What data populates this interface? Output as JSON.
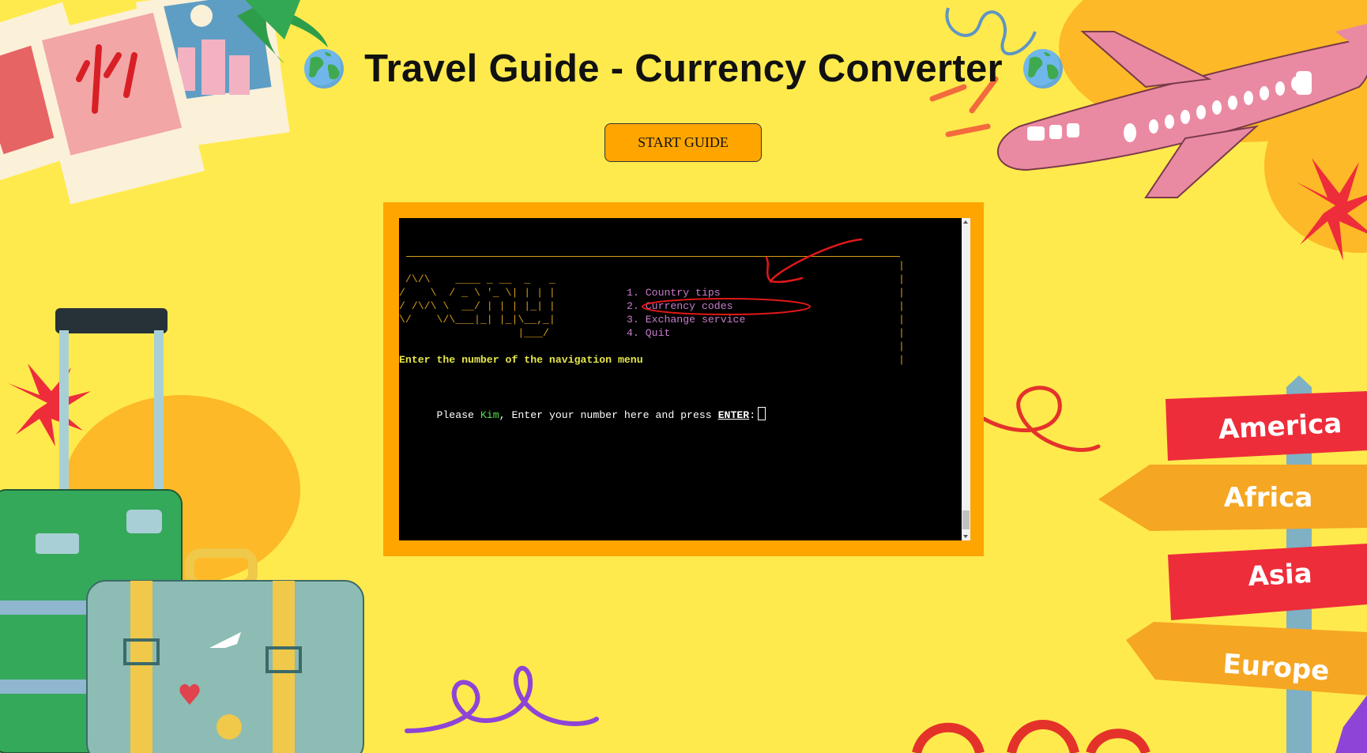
{
  "header": {
    "title": "Travel Guide - Currency Converter",
    "left_icon": "globe-icon",
    "right_icon": "globe-icon"
  },
  "start_button": {
    "label": "START GUIDE"
  },
  "terminal": {
    "ascii_art": [
      " /\\/\\    ____ _ __  _   _ ",
      "/    \\  / _ \\ '_ \\| | | |",
      "/ /\\/\\ \\  __/ | | | |_| |",
      "\\/    \\/\\___|_| |_|\\__,_|",
      "                   |___/"
    ],
    "menu_items": [
      "1. Country tips",
      "2. Currency codes",
      "3. Exchange service",
      "4. Quit"
    ],
    "instruction": "Enter the number of the navigation menu",
    "prompt_prefix": "Please ",
    "user_name": "Kim",
    "prompt_middle": ", Enter your number here and press ",
    "prompt_key": "ENTER",
    "prompt_suffix": ":"
  },
  "signpost": {
    "signs": [
      "America",
      "Africa",
      "Asia",
      "Europe"
    ]
  },
  "colors": {
    "background": "#FFEA4D",
    "accent": "#FFA500",
    "terminal_bg": "#000000",
    "menu_text": "#c77dca",
    "ascii_text": "#d49a1a",
    "instruction_text": "#e6e64a",
    "username_text": "#4ee04e",
    "annotation_red": "#e01818",
    "sign_red": "#ee2d3a",
    "sign_orange": "#f5a623"
  },
  "decorations": [
    "photo-polaroids",
    "palm-leaf",
    "airplane",
    "flower",
    "suitcases",
    "squiggle",
    "signpost"
  ]
}
